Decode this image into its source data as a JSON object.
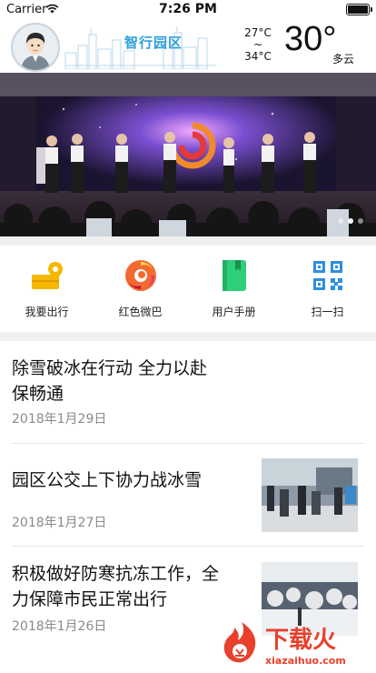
{
  "status_bar": {
    "carrier": "Carrier",
    "time": "7:26 PM"
  },
  "header": {
    "brand": "智行园区",
    "temp_high": "27°C",
    "temp_sep": "~",
    "temp_low": "34°C",
    "current_temp": "30°",
    "condition": "多云"
  },
  "banner": {
    "slide_count": 3,
    "active_slide": 1
  },
  "quick_actions": [
    {
      "label": "我要出行",
      "icon": "map-pin-icon"
    },
    {
      "label": "红色微巴",
      "icon": "swirl-logo-icon"
    },
    {
      "label": "用户手册",
      "icon": "book-icon"
    },
    {
      "label": "扫一扫",
      "icon": "qr-scan-icon"
    }
  ],
  "news": [
    {
      "title_line1": "除雪破冰在行动 全力以赴",
      "title_line2": "保畅通",
      "date": "2018年1月29日"
    },
    {
      "title_line1": "园区公交上下协力战冰雪",
      "date": "2018年1月27日"
    },
    {
      "title_line1": "积极做好防寒抗冻工作，全",
      "title_line2": "力保障市民正常出行",
      "date": "2018年1月26日"
    }
  ],
  "watermark": {
    "text": "下载火",
    "url_text": "xiazaihuo.com"
  },
  "colors": {
    "brand_blue": "#2d9fdc",
    "accent_red": "#e8402c",
    "book_green": "#2ecf7a",
    "qr_blue": "#2d8fe0",
    "map_yellow": "#f5b800"
  }
}
